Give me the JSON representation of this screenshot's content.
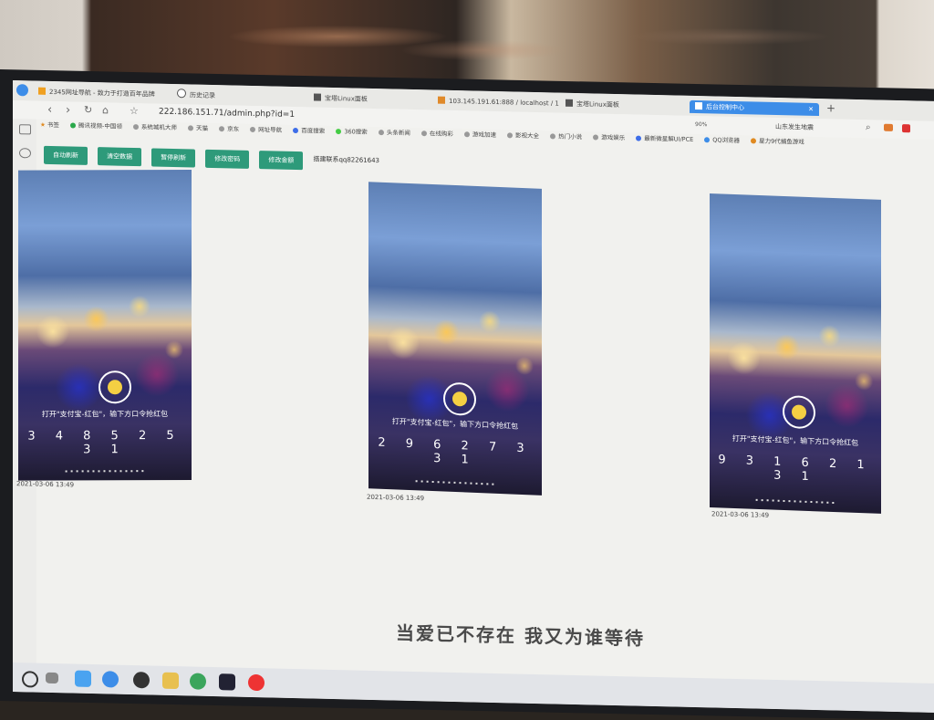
{
  "browser": {
    "tabs": [
      {
        "label": "2345网址导航 - 致力于打造百年品牌",
        "icon": "browser-logo-icon"
      },
      {
        "label": "历史记录",
        "icon": "history-icon"
      },
      {
        "label": "宝塔Linux面板",
        "icon": "panel-icon"
      },
      {
        "label": "103.145.191.61:888 / localhost / 1",
        "icon": "page-icon"
      },
      {
        "label": "宝塔Linux面板",
        "icon": "panel-icon"
      },
      {
        "label": "后台控制中心",
        "icon": "page-icon",
        "active": true
      }
    ],
    "url": "222.186.151.71/admin.php?id=1",
    "zoom": "90%",
    "weather": "山东发生地震",
    "bookmarks": [
      "书签",
      "腾讯视频-中国领",
      "系统城机大师",
      "天猫",
      "京东",
      "网址导航",
      "百度搜索",
      "360搜索",
      "头条新闻",
      "在线购彩",
      "游戏加速",
      "影视大全",
      "热门小说",
      "游戏娱乐",
      "最新微星解UI/PCE",
      "QQ浏览器",
      "星力9代捕鱼游戏"
    ]
  },
  "toolbar": {
    "buttons": [
      "自动刷新",
      "清空数据",
      "暂停刷新",
      "修改密码",
      "修改金额"
    ],
    "contact": "搭建联系qq82261643"
  },
  "phones": [
    {
      "instruction": "打开\"支付宝-红包\"，输下方口令抢红包",
      "code": "3 4 8 5 2 5 3 1",
      "timestamp": "2021-03-06 13:49"
    },
    {
      "instruction": "打开\"支付宝-红包\"，输下方口令抢红包",
      "code": "2 9 6 2 7 3 3 1",
      "timestamp": "2021-03-06 13:49"
    },
    {
      "instruction": "打开\"支付宝-红包\"，输下方口令抢红包",
      "code": "9 3 1 6 2 1 3 1",
      "timestamp": "2021-03-06 13:49"
    }
  ],
  "subtitle": "当爱已不存在 我又为谁等待",
  "colors": {
    "accent": "#3d8de8",
    "button": "#2e9a7a",
    "coin": "#f4cf43"
  }
}
